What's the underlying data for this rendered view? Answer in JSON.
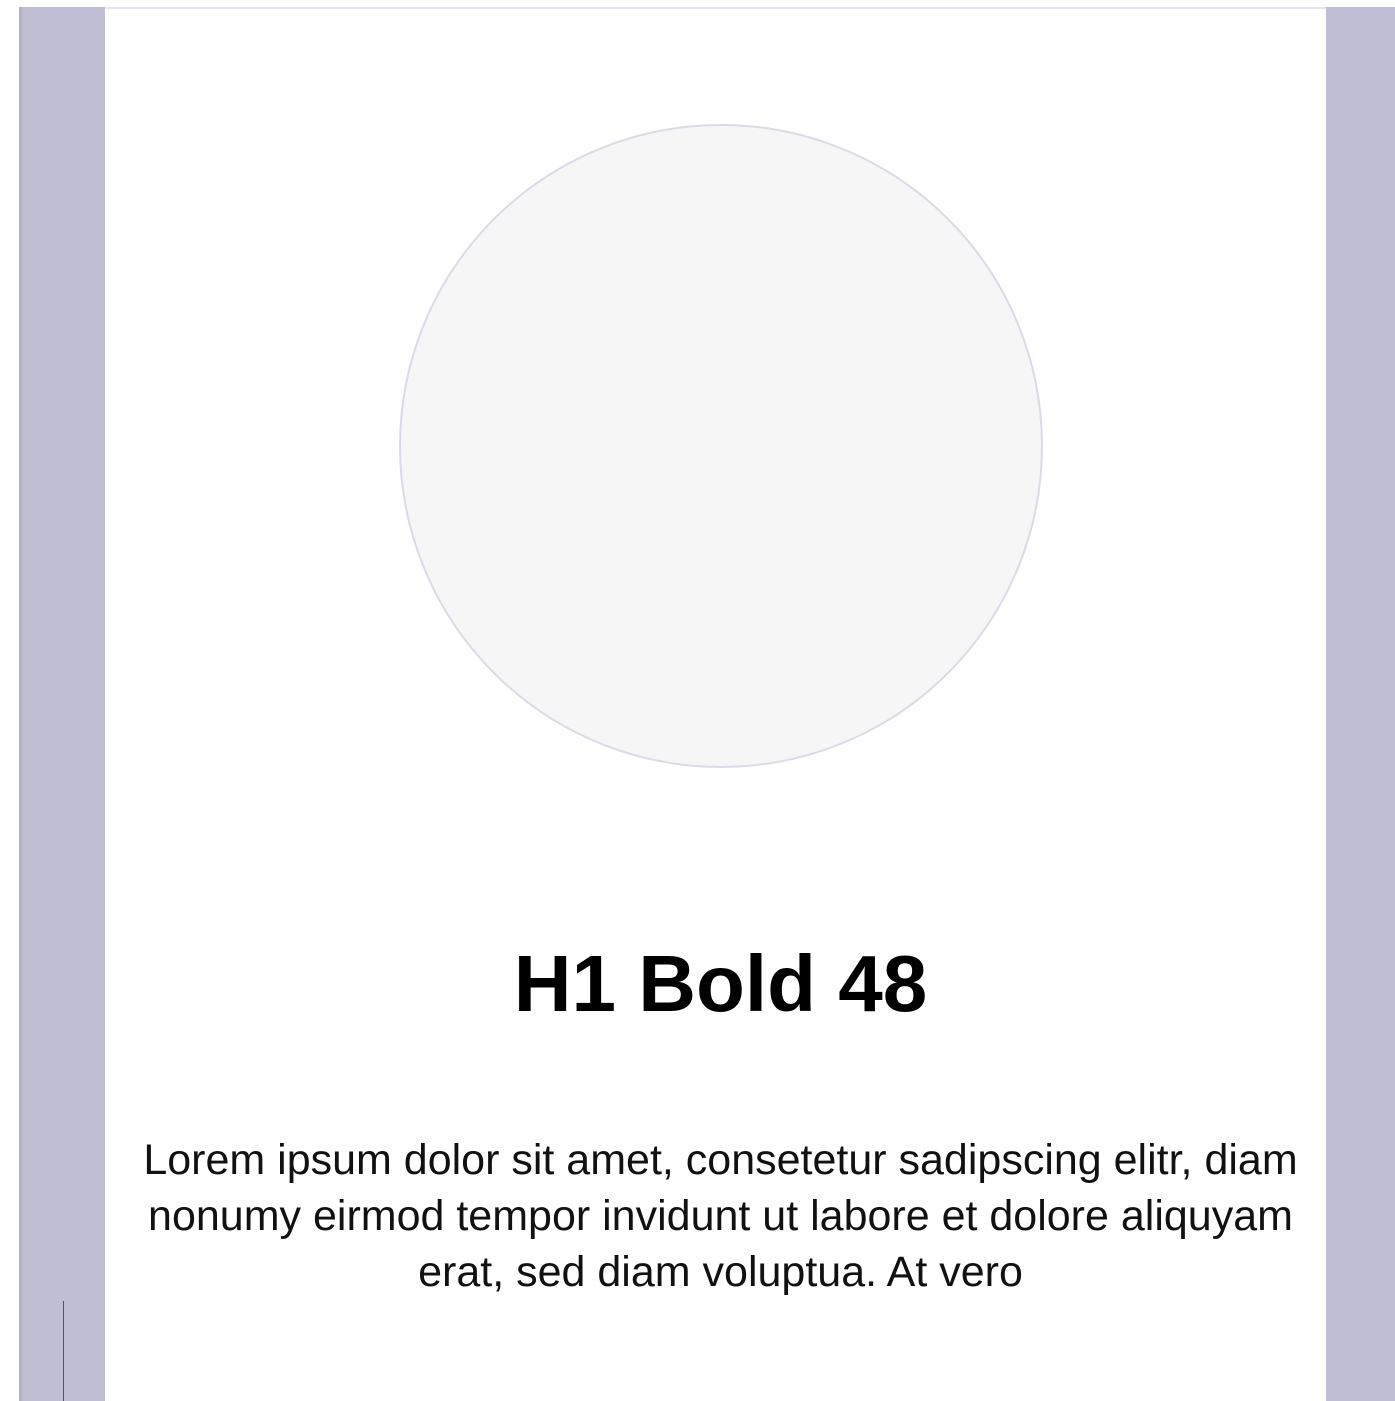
{
  "colors": {
    "guide": "#c0bed4",
    "placeholder_fill": "#f6f6f7",
    "placeholder_border": "#dcdae6",
    "text": "#000000"
  },
  "card": {
    "image_icon": "circle-image-placeholder",
    "heading": "H1 Bold 48",
    "body": "Lorem ipsum dolor sit amet, consetetur sadipscing elitr, diam nonumy eirmod tempor invidunt ut labore et dolore aliquyam erat, sed diam voluptua. At vero"
  }
}
